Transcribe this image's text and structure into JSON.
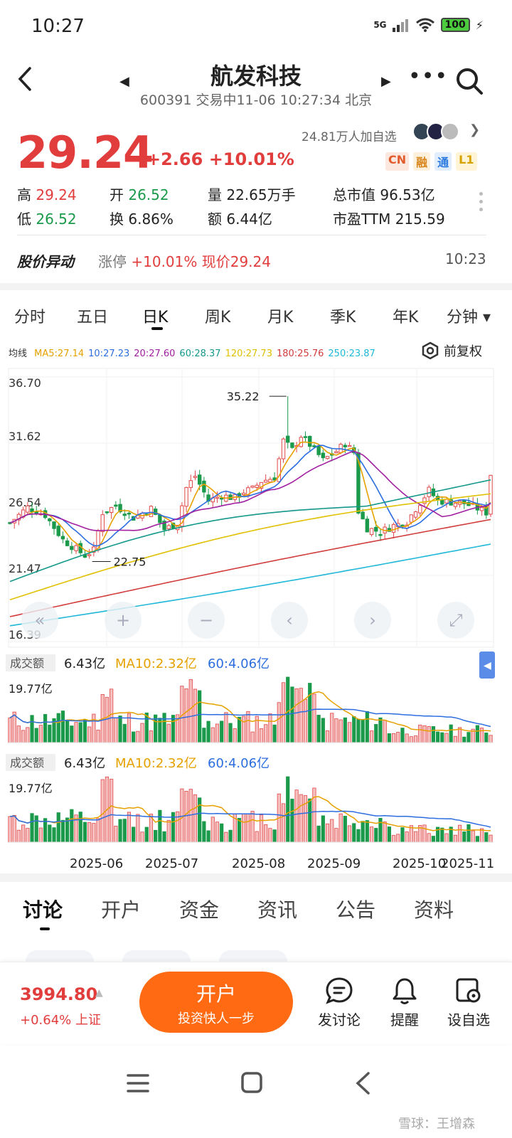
{
  "status": {
    "time": "10:27",
    "network": "5G",
    "battery": "100"
  },
  "header": {
    "title": "航发科技",
    "subtitle": "600391 交易中11-06 10:27:34 北京"
  },
  "quote": {
    "price": "29.24",
    "change": "+2.66",
    "change_pct": "+10.01%",
    "followers": "24.81万人加自选",
    "badges": [
      "CN",
      "融",
      "通",
      "L1"
    ],
    "stats": [
      {
        "label": "高",
        "value": "29.24",
        "color": "#e23d3d"
      },
      {
        "label": "开",
        "value": "26.52",
        "color": "#1a9a4a"
      },
      {
        "label": "量",
        "value": "22.65万手",
        "color": "#222"
      },
      {
        "label": "总市值",
        "value": "96.53亿",
        "color": "#222"
      },
      {
        "label": "低",
        "value": "26.52",
        "color": "#1a9a4a"
      },
      {
        "label": "换",
        "value": "6.86%",
        "color": "#222"
      },
      {
        "label": "额",
        "value": "6.44亿",
        "color": "#222"
      },
      {
        "label": "市盈TTM",
        "value": "215.59",
        "color": "#222"
      }
    ]
  },
  "alert": {
    "title": "股价异动",
    "label": "涨停",
    "text": "+10.01% 现价29.24",
    "time": "10:23"
  },
  "tabs": [
    "分时",
    "五日",
    "日K",
    "周K",
    "月K",
    "季K",
    "年K",
    "分钟"
  ],
  "ma": {
    "label": "均线",
    "items": [
      {
        "text": "MA5:27.14",
        "color": "#e6a100"
      },
      {
        "text": "10:27.23",
        "color": "#2c6ee0"
      },
      {
        "text": "20:27.60",
        "color": "#a020a0"
      },
      {
        "text": "60:28.37",
        "color": "#14988a"
      },
      {
        "text": "120:27.73",
        "color": "#e0c000"
      },
      {
        "text": "180:25.76",
        "color": "#d23c3c"
      },
      {
        "text": "250:23.87",
        "color": "#20b8d8"
      }
    ],
    "adjust": "前复权"
  },
  "chart_data": {
    "type": "candlestick",
    "y_ticks": [
      "36.70",
      "31.62",
      "26.54",
      "21.47",
      "16.39"
    ],
    "ylim": [
      16.39,
      36.7
    ],
    "x_ticks": [
      "2025-06",
      "2025-07",
      "2025-08",
      "2025-09",
      "2025-10",
      "2025-11"
    ],
    "annotations": {
      "high": "35.22",
      "low": "22.75"
    },
    "volume_panels": [
      {
        "label": "成交额",
        "value": "6.43亿",
        "ma10": "MA10:2.32亿",
        "ma60": "60:4.06亿",
        "max": "19.77亿"
      },
      {
        "label": "成交额",
        "value": "6.43亿",
        "ma10": "MA10:2.32亿",
        "ma60": "60:4.06亿",
        "max": "19.77亿"
      }
    ]
  },
  "bottom_tabs": [
    "讨论",
    "开户",
    "资金",
    "资讯",
    "公告",
    "资料"
  ],
  "action_bar": {
    "index_value": "3994.80",
    "index_change": "+0.64% 上证",
    "open_title": "开户",
    "open_sub": "投资快人一步",
    "actions": [
      "发讨论",
      "提醒",
      "设自选"
    ]
  },
  "watermark": "雪球：王增森"
}
